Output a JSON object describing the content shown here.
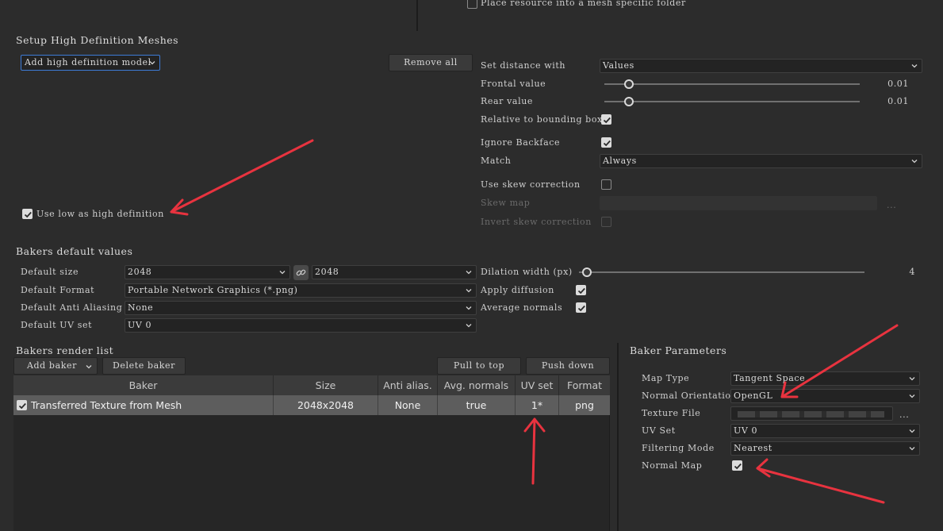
{
  "top": {
    "place_resource_label": "Place resource into a mesh specific folder",
    "place_resource_checked": false
  },
  "hd_meshes": {
    "title": "Setup High Definition Meshes",
    "add_model_label": "Add high definition model",
    "remove_all_label": "Remove all",
    "use_low_as_high_label": "Use low as high definition",
    "use_low_as_high_checked": true
  },
  "distance": {
    "set_distance_label": "Set distance with",
    "set_distance_value": "Values",
    "frontal_label": "Frontal value",
    "frontal_value": "0.01",
    "rear_label": "Rear value",
    "rear_value": "0.01",
    "relative_label": "Relative to bounding box",
    "relative_checked": true,
    "ignore_backface_label": "Ignore Backface",
    "ignore_backface_checked": true,
    "match_label": "Match",
    "match_value": "Always",
    "skew_label": "Use skew correction",
    "skew_checked": false,
    "skew_map_label": "Skew map",
    "skew_map_ellipsis": "...",
    "invert_skew_label": "Invert skew correction",
    "invert_skew_checked": false
  },
  "defaults": {
    "title": "Bakers default values",
    "size_label": "Default size",
    "size_w": "2048",
    "size_h": "2048",
    "format_label": "Default Format",
    "format_value": "Portable Network Graphics (*.png)",
    "aa_label": "Default Anti Aliasing",
    "aa_value": "None",
    "uv_label": "Default UV set",
    "uv_value": "UV 0",
    "dilation_label": "Dilation width (px)",
    "dilation_value": "4",
    "apply_diffusion_label": "Apply diffusion",
    "apply_diffusion_checked": true,
    "avg_normals_label": "Average normals",
    "avg_normals_checked": true
  },
  "render_list": {
    "title": "Bakers render list",
    "add_baker_label": "Add baker",
    "delete_baker_label": "Delete baker",
    "pull_top_label": "Pull to top",
    "push_down_label": "Push down",
    "columns": [
      "Baker",
      "Size",
      "Anti alias.",
      "Avg. normals",
      "UV set",
      "Format"
    ],
    "rows": [
      {
        "checked": true,
        "baker": "Transferred Texture from Mesh",
        "size": "2048x2048",
        "aa": "None",
        "avg": "true",
        "uv": "1*",
        "format": "png"
      }
    ]
  },
  "baker_params": {
    "title": "Baker Parameters",
    "map_type_label": "Map Type",
    "map_type_value": "Tangent Space",
    "normal_orientation_label": "Normal Orientation",
    "normal_orientation_value": "OpenGL",
    "texture_file_label": "Texture File",
    "texture_file_ellipsis": "...",
    "uv_set_label": "UV Set",
    "uv_set_value": "UV 0",
    "filtering_label": "Filtering Mode",
    "filtering_value": "Nearest",
    "normal_map_label": "Normal Map",
    "normal_map_checked": true
  },
  "icons": {
    "chevron": "chevron-down-icon",
    "link": "link-icon",
    "check": "check-icon",
    "annotation": "red-arrow"
  },
  "colors": {
    "background": "#2c2c2c",
    "annotation_red": "#e8333f",
    "focus_border": "#3d7bd6",
    "selected_row": "#5d5d5d"
  }
}
